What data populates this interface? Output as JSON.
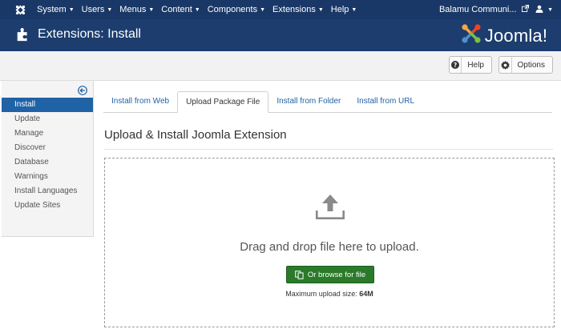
{
  "topbar": {
    "menu": [
      {
        "label": "System"
      },
      {
        "label": "Users"
      },
      {
        "label": "Menus"
      },
      {
        "label": "Content"
      },
      {
        "label": "Components"
      },
      {
        "label": "Extensions"
      },
      {
        "label": "Help"
      }
    ],
    "site_name": "Balamu Communi...",
    "bg_color": "#1a3867"
  },
  "header": {
    "title": "Extensions: Install",
    "brand": "Joomla",
    "brand_mark": "!"
  },
  "toolbar": {
    "help_label": "Help",
    "options_label": "Options"
  },
  "sidebar": {
    "items": [
      {
        "label": "Install",
        "active": true
      },
      {
        "label": "Update"
      },
      {
        "label": "Manage"
      },
      {
        "label": "Discover"
      },
      {
        "label": "Database"
      },
      {
        "label": "Warnings"
      },
      {
        "label": "Install Languages"
      },
      {
        "label": "Update Sites"
      }
    ],
    "active_color": "#1f62a6"
  },
  "tabs": [
    {
      "label": "Install from Web"
    },
    {
      "label": "Upload Package File",
      "active": true
    },
    {
      "label": "Install from Folder"
    },
    {
      "label": "Install from URL"
    }
  ],
  "main": {
    "section_title": "Upload & Install Joomla Extension",
    "drop_text": "Drag and drop file here to upload.",
    "browse_label": "Or browse for file",
    "max_label": "Maximum upload size:",
    "max_value": "64M",
    "browse_color": "#2a7a2a"
  }
}
